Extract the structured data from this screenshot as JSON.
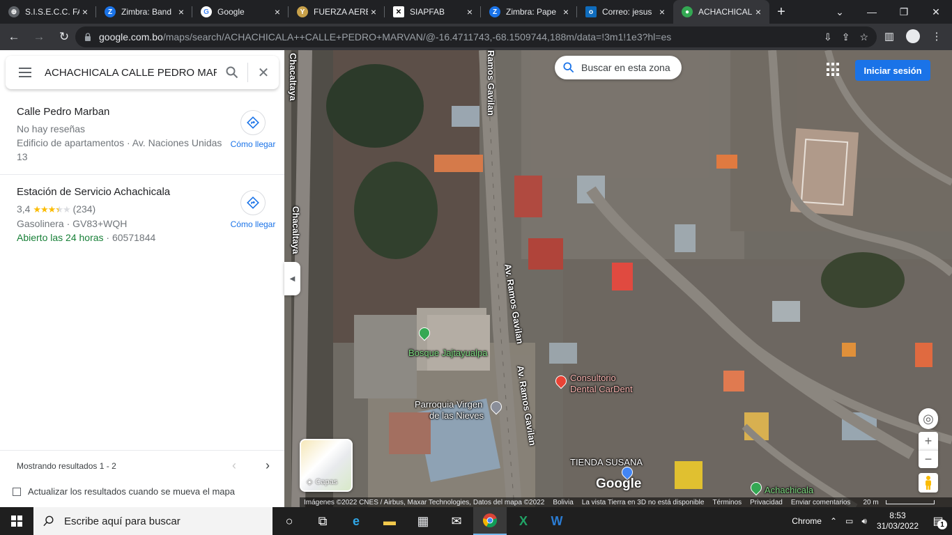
{
  "browser": {
    "tabs": [
      {
        "title": "S.I.S.E.C.C. FA",
        "icon": "globe-icon",
        "color": "#5f6368"
      },
      {
        "title": "Zimbra: Band",
        "icon": "zimbra-icon",
        "color": "#1a73e8"
      },
      {
        "title": "Google",
        "icon": "google-icon",
        "color": "#ffffff"
      },
      {
        "title": "FUERZA AERE",
        "icon": "emblem-icon",
        "color": "#c8a14a"
      },
      {
        "title": "SIAPFAB",
        "icon": "siapfab-icon",
        "color": "#ffffff"
      },
      {
        "title": "Zimbra: Pape",
        "icon": "zimbra-icon",
        "color": "#1a73e8"
      },
      {
        "title": "Correo: jesus",
        "icon": "outlook-icon",
        "color": "#0f6cbd"
      },
      {
        "title": "ACHACHICAL",
        "icon": "maps-icon",
        "color": "#34a853"
      }
    ],
    "active_tab": 7,
    "url_host": "google.com.bo",
    "url_path": "/maps/search/ACHACHICALA++CALLE+PEDRO+MARVAN/@-16.4711743,-68.1509744,188m/data=!3m1!1e3?hl=es"
  },
  "search": {
    "query": "ACHACHICALA  CALLE PEDRO MARVAN"
  },
  "results": [
    {
      "name": "Calle Pedro Marban",
      "line1": "No hay reseñas",
      "line2": "Edificio de apartamentos · Av. Naciones Unidas",
      "line3": "13",
      "directions_label": "Cómo llegar"
    },
    {
      "name": "Estación de Servicio Achachicala",
      "rating": "3,4",
      "rating_value": 3.4,
      "reviews": "(234)",
      "line2": "Gasolinera · GV83+WQH",
      "open": "Abierto las 24 horas",
      "phone": " · 60571844",
      "directions_label": "Cómo llegar"
    }
  ],
  "pager": {
    "text": "Mostrando resultados 1 - 2"
  },
  "update_label": "Actualizar los resultados cuando se mueva el mapa",
  "map": {
    "search_area_label": "Buscar en esta zona",
    "signin_label": "Iniciar sesión",
    "layers_label": "Capas",
    "google_logo": "Google",
    "labels": {
      "chacaltaya_top": "Chacaltaya",
      "chacaltaya_mid": "Chacaltaya",
      "ramos_top": "Ramos Gavilan",
      "ramos_mid": "Av. Ramos Gavilan",
      "ramos_low": "Av. Ramos Gavilan",
      "bosque": "Bosque Jajtayualpa",
      "parroquia_1": "Parroquia Virgen",
      "parroquia_2": "de las Nieves",
      "consultorio_1": "Consultorio",
      "consultorio_2": "Dental CarDent",
      "tienda": "TIENDA SUSANA",
      "achachicala": "Achachicala"
    },
    "attribution": {
      "imagery": "Imágenes ©2022 CNES / Airbus, Maxar Technologies, Datos del mapa ©2022",
      "country": "Bolivia",
      "earth": "La vista Tierra en 3D no está disponible",
      "terms": "Términos",
      "privacy": "Privacidad",
      "feedback": "Enviar comentarios",
      "scale": "20 m"
    }
  },
  "taskbar": {
    "search_placeholder": "Escribe aquí para buscar",
    "tray_app": "Chrome",
    "time": "8:53",
    "date": "31/03/2022",
    "notification_count": "1"
  }
}
